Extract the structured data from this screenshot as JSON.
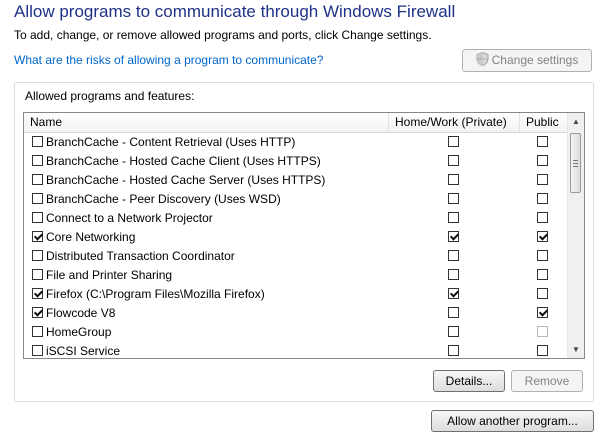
{
  "header": {
    "title": "Allow programs to communicate through Windows Firewall",
    "subtitle": "To add, change, or remove allowed programs and ports, click Change settings.",
    "risk_link": "What are the risks of allowing a program to communicate?",
    "change_settings_label": "Change settings"
  },
  "group": {
    "label": "Allowed programs and features:",
    "columns": {
      "name": "Name",
      "home_work": "Home/Work (Private)",
      "public": "Public"
    },
    "programs": [
      {
        "name": "BranchCache - Content Retrieval (Uses HTTP)",
        "enabled": false,
        "home_work": false,
        "public": false
      },
      {
        "name": "BranchCache - Hosted Cache Client (Uses HTTPS)",
        "enabled": false,
        "home_work": false,
        "public": false
      },
      {
        "name": "BranchCache - Hosted Cache Server (Uses HTTPS)",
        "enabled": false,
        "home_work": false,
        "public": false
      },
      {
        "name": "BranchCache - Peer Discovery (Uses WSD)",
        "enabled": false,
        "home_work": false,
        "public": false
      },
      {
        "name": "Connect to a Network Projector",
        "enabled": false,
        "home_work": false,
        "public": false
      },
      {
        "name": "Core Networking",
        "enabled": true,
        "home_work": true,
        "public": true
      },
      {
        "name": "Distributed Transaction Coordinator",
        "enabled": false,
        "home_work": false,
        "public": false
      },
      {
        "name": "File and Printer Sharing",
        "enabled": false,
        "home_work": false,
        "public": false
      },
      {
        "name": "Firefox (C:\\Program Files\\Mozilla Firefox)",
        "enabled": true,
        "home_work": true,
        "public": false
      },
      {
        "name": "Flowcode V8",
        "enabled": true,
        "home_work": false,
        "public": true
      },
      {
        "name": "HomeGroup",
        "enabled": false,
        "home_work": false,
        "public": false,
        "public_disabled": true
      },
      {
        "name": "iSCSI Service",
        "enabled": false,
        "home_work": false,
        "public": false
      }
    ],
    "details_label": "Details...",
    "remove_label": "Remove"
  },
  "footer": {
    "allow_another_label": "Allow another program..."
  },
  "colors": {
    "title": "#1e3287",
    "link": "#0066cc",
    "disabled_text": "#838383"
  }
}
